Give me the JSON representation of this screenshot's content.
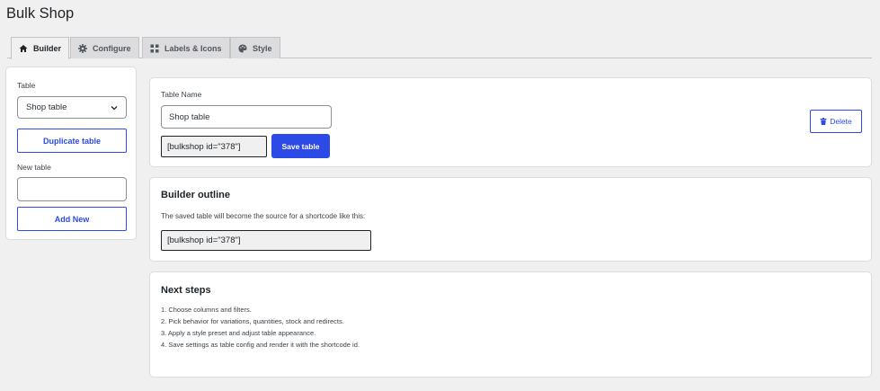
{
  "page": {
    "title": "Bulk Shop"
  },
  "tabs": [
    {
      "label": "Builder",
      "icon": "home-icon",
      "active": true
    },
    {
      "label": "Configure",
      "icon": "gear-icon",
      "active": false
    },
    {
      "label": "Labels & Icons",
      "icon": "grid-icon",
      "active": false
    },
    {
      "label": "Style",
      "icon": "palette-icon",
      "active": false
    }
  ],
  "sidebar": {
    "table_label": "Table",
    "table_select_value": "Shop table",
    "duplicate_label": "Duplicate table",
    "new_table_label": "New table",
    "new_table_value": "",
    "add_new_label": "Add New"
  },
  "table_settings": {
    "name_label": "Table Name",
    "name_value": "Shop table",
    "shortcode": "[bulkshop id=\"378\"]",
    "save_label": "Save table",
    "delete_label": "Delete",
    "delete_icon": "trash-icon"
  },
  "outline": {
    "title": "Builder outline",
    "description": "The saved table will become the source for a shortcode like this:",
    "shortcode": "[bulkshop id=\"378\"]"
  },
  "next_steps": {
    "title": "Next steps",
    "items": [
      "1. Choose columns and filters.",
      "2. Pick behavior for variations, quantities, stock and redirects.",
      "3. Apply a style preset and adjust table appearance.",
      "4. Save settings as table config and render it with the shortcode id."
    ]
  },
  "colors": {
    "accent": "#2c4ae6",
    "background": "#f0f0f1",
    "card": "#ffffff",
    "text": "#1d2327"
  }
}
